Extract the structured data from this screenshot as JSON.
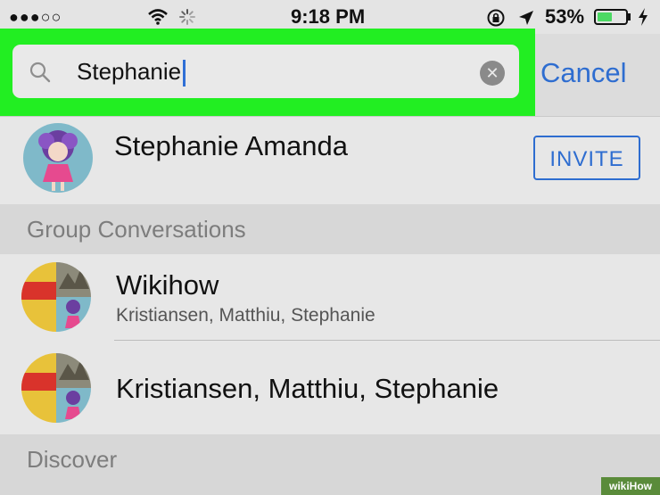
{
  "status_bar": {
    "signal": "●●●○○",
    "time": "9:18 PM",
    "battery_percent": "53%",
    "battery_level": 0.53,
    "battery_color": "#4cd964"
  },
  "search": {
    "value": "Stephanie",
    "cancel_label": "Cancel",
    "highlight_color": "#22ee22"
  },
  "contacts": [
    {
      "name": "Stephanie Amanda",
      "action_label": "INVITE"
    }
  ],
  "sections": {
    "group_conversations": "Group Conversations",
    "discover": "Discover"
  },
  "groups": [
    {
      "title": "Wikihow",
      "members": "Kristiansen, Matthiu, Stephanie"
    },
    {
      "title": "Kristiansen, Matthiu, Stephanie",
      "members": ""
    }
  ],
  "watermark": "wikiHow"
}
